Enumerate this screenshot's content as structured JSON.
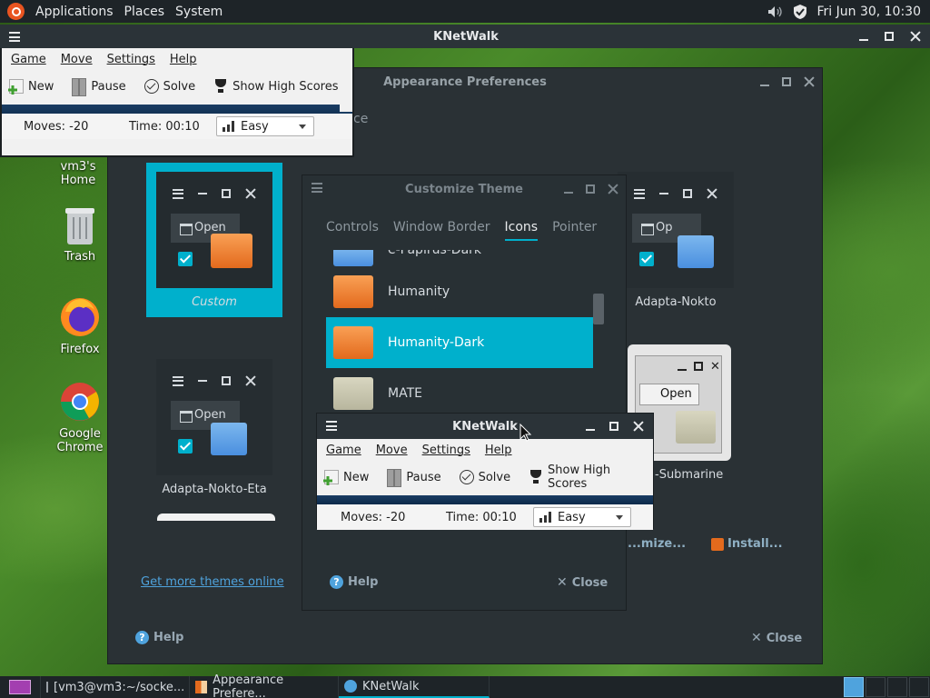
{
  "top_panel": {
    "menu": [
      "Applications",
      "Places",
      "System"
    ],
    "clock": "Fri Jun 30, 10:30"
  },
  "desktop": {
    "icons": [
      {
        "label": "vm3's Home"
      },
      {
        "label": "Trash"
      },
      {
        "label": "Firefox"
      },
      {
        "label": "Google Chrome"
      }
    ]
  },
  "appearance": {
    "title": "Appearance Preferences",
    "tab_hint": "ce",
    "themes": [
      {
        "name": "Custom"
      },
      {
        "name": "Adapta-Nokto"
      },
      {
        "name": "Adapta-Nokto-Eta"
      },
      {
        "name": "-Submarine"
      }
    ],
    "open_label": "Open",
    "open_label_trunc": "Op",
    "get_more": "Get more themes online",
    "customize": "...mize...",
    "install": "Install...",
    "help": "Help",
    "close": "Close"
  },
  "customize": {
    "title": "Customize Theme",
    "tabs": [
      "Controls",
      "Window Border",
      "Icons",
      "Pointer"
    ],
    "active_tab": "Icons",
    "icon_themes": [
      {
        "name": "e-Papirus-Dark"
      },
      {
        "name": "Humanity"
      },
      {
        "name": "Humanity-Dark"
      },
      {
        "name": "MATE"
      }
    ],
    "help": "Help",
    "close": "Close"
  },
  "knetwalk": {
    "title": "KNetWalk",
    "menu": [
      "Game",
      "Move",
      "Settings",
      "Help"
    ],
    "toolbar": {
      "new": "New",
      "pause": "Pause",
      "solve": "Solve",
      "high_scores": "Show High Scores"
    },
    "status": {
      "moves": "Moves: -20",
      "time": "Time: 00:10",
      "difficulty": "Easy"
    }
  },
  "taskbar": {
    "tasks": [
      {
        "label": "[vm3@vm3:~/socke..."
      },
      {
        "label": "Appearance Prefere..."
      },
      {
        "label": "KNetWalk"
      }
    ]
  }
}
